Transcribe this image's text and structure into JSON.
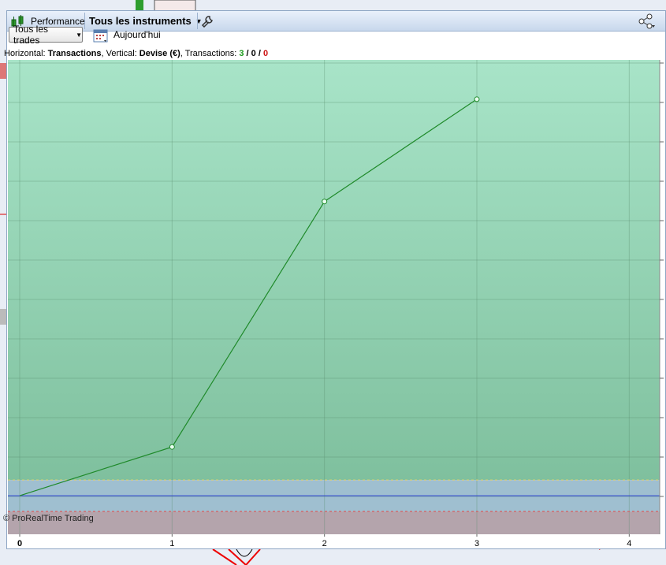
{
  "toolbar": {
    "title": "Performance",
    "instrument_selector": "Tous les instruments"
  },
  "subbar": {
    "trade_filter": "Tous les trades",
    "date_label": "Aujourd'hui"
  },
  "info": {
    "h_prefix": "Horizontal: ",
    "h_value": "Transactions",
    "v_prefix": ", Vertical: ",
    "v_value": "Devise (€)",
    "t_prefix": ", Transactions: ",
    "t_total": "3",
    "slash1": " / ",
    "t_zero": "0",
    "slash2": " / ",
    "t_loss": "0"
  },
  "copyright": "© ProRealTime Trading",
  "colors": {
    "line": "#1f8a2a",
    "zero_line": "#2b3fd6",
    "loss_dash": "#e04a4a",
    "gain_dash": "#e8d36a",
    "total_color": "#1a9a1a",
    "loss_color": "#cc1111"
  },
  "chart_data": {
    "type": "line",
    "x": [
      0,
      1,
      2,
      3
    ],
    "y": [
      0,
      62,
      374,
      504
    ],
    "xlim": [
      0,
      4.2
    ],
    "ylim": [
      -49,
      554
    ],
    "xticks": [
      "0",
      "1",
      "2",
      "3",
      "4"
    ],
    "xlabel": "Transactions",
    "ylabel": "Devise (€)",
    "grid": true
  }
}
